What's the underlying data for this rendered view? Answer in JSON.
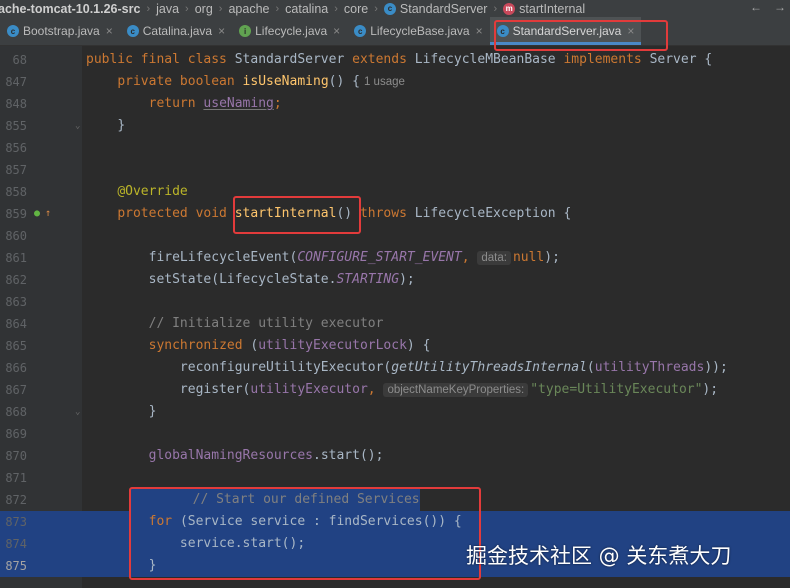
{
  "breadcrumb": {
    "items": [
      {
        "label": "ache-tomcat-10.1.26-src",
        "icon": ""
      },
      {
        "label": "java",
        "icon": ""
      },
      {
        "label": "org",
        "icon": ""
      },
      {
        "label": "apache",
        "icon": ""
      },
      {
        "label": "catalina",
        "icon": ""
      },
      {
        "label": "core",
        "icon": ""
      },
      {
        "label": "StandardServer",
        "icon": "class-icon"
      },
      {
        "label": "startInternal",
        "icon": "method-icon"
      }
    ]
  },
  "tabs": [
    {
      "label": "Bootstrap.java",
      "icon": "class-icon",
      "active": false
    },
    {
      "label": "Catalina.java",
      "icon": "class-icon",
      "active": false
    },
    {
      "label": "Lifecycle.java",
      "icon": "interface-icon",
      "active": false
    },
    {
      "label": "LifecycleBase.java",
      "icon": "class-icon",
      "active": false
    },
    {
      "label": "StandardServer.java",
      "icon": "class-icon",
      "active": true
    }
  ],
  "colors": {
    "selection": "#214283",
    "highlight_box": "#e23b3b",
    "keyword": "#cc7832",
    "method": "#ffc66d"
  },
  "code": {
    "l68": {
      "num": "68",
      "t1": "public final class ",
      "t2": "StandardServer ",
      "t3": "extends ",
      "t4": "LifecycleMBeanBase ",
      "t5": "implements ",
      "t6": "Server {"
    },
    "l847": {
      "num": "847",
      "t1": "private boolean ",
      "t2": "isUseNaming",
      "t3": "() {",
      "usage": "1 usage"
    },
    "l848": {
      "num": "848",
      "t1": "return ",
      "t2": "useNaming",
      "t3": ";"
    },
    "l855": {
      "num": "855",
      "t1": "}"
    },
    "l856": {
      "num": "856"
    },
    "l857": {
      "num": "857"
    },
    "l858": {
      "num": "858",
      "t1": "@Override"
    },
    "l859": {
      "num": "859",
      "t1": "protected void ",
      "t2": "startInternal",
      "t3": "() ",
      "t4": "throws ",
      "t5": "LifecycleException {"
    },
    "l860": {
      "num": "860"
    },
    "l861": {
      "num": "861",
      "t1": "fireLifecycleEvent(",
      "t2": "CONFIGURE_START_EVENT",
      "t3": ", ",
      "hint": "data:",
      "t4": "null",
      "t5": ");"
    },
    "l862": {
      "num": "862",
      "t1": "setState(LifecycleState.",
      "t2": "STARTING",
      "t3": ");"
    },
    "l863": {
      "num": "863"
    },
    "l864": {
      "num": "864",
      "t1": "// Initialize utility executor"
    },
    "l865": {
      "num": "865",
      "t1": "synchronized ",
      "t2": "(",
      "t3": "utilityExecutorLock",
      "t4": ") {"
    },
    "l866": {
      "num": "866",
      "t1": "reconfigureUtilityExecutor(",
      "t2": "getUtilityThreadsInternal",
      "t3": "(",
      "t4": "utilityThreads",
      "t5": "));"
    },
    "l867": {
      "num": "867",
      "t1": "register(",
      "t2": "utilityExecutor",
      "t3": ", ",
      "hint": "objectNameKeyProperties:",
      "t4": "\"type=UtilityExecutor\"",
      "t5": ");"
    },
    "l868": {
      "num": "868",
      "t1": "}"
    },
    "l869": {
      "num": "869"
    },
    "l870": {
      "num": "870",
      "t1": "globalNamingResources",
      "t2": ".start();"
    },
    "l871": {
      "num": "871"
    },
    "l872": {
      "num": "872",
      "t1": "// Start our defined Services"
    },
    "l873": {
      "num": "873",
      "t1": "for ",
      "t2": "(Service service : findServices()) {"
    },
    "l874": {
      "num": "874",
      "t1": "service.start();"
    },
    "l875": {
      "num": "875",
      "t1": "}"
    }
  },
  "watermark": "掘金技术社区 @ 关东煮大刀"
}
